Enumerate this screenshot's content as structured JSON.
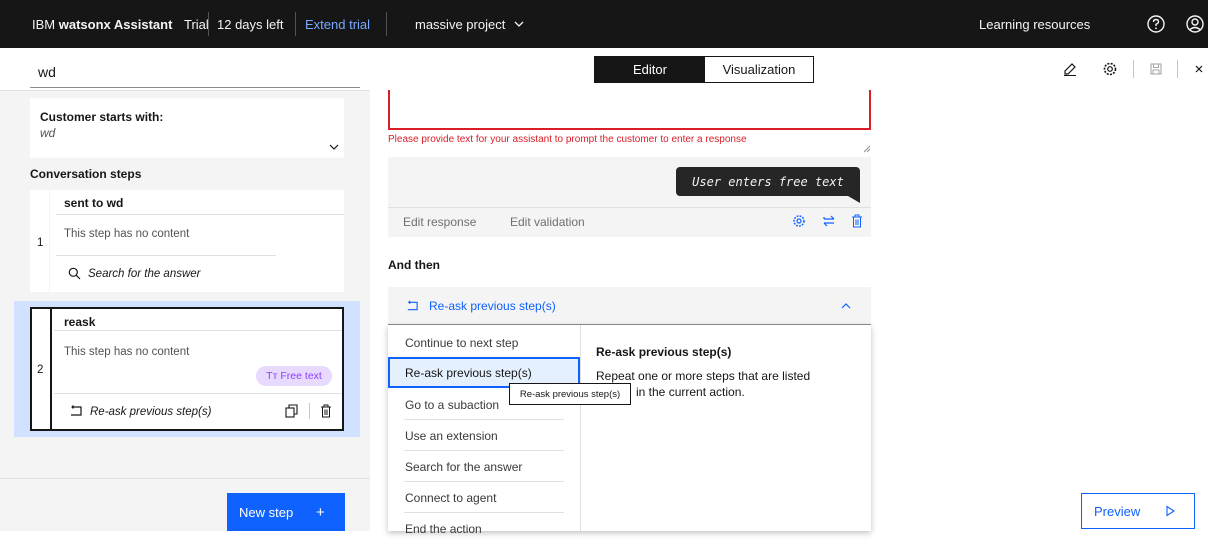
{
  "topbar": {
    "brand_company": "IBM",
    "brand_product": "watsonx Assistant",
    "plan": "Trial",
    "days_left": "12 days left",
    "extend_trial": "Extend trial",
    "project": "massive project",
    "learning_resources": "Learning resources",
    "icons": [
      "help-icon",
      "user-icon"
    ]
  },
  "action_search": {
    "value": "wd"
  },
  "view_toggle": {
    "editor": "Editor",
    "visualization": "Visualization",
    "selected": "Editor"
  },
  "toolbar_icons": [
    "edit-icon",
    "settings-icon",
    "save-icon",
    "close-icon"
  ],
  "left_panel": {
    "customer_starts_label": "Customer starts with:",
    "customer_starts_value": "wd",
    "steps_heading": "Conversation steps",
    "steps": [
      {
        "number": "1",
        "title": "sent to wd",
        "content": "This step has no content",
        "footer": "Search for the answer"
      },
      {
        "number": "2",
        "title": "reask",
        "content": "This step has no content",
        "badge": "Free text",
        "badge_prefix": "Tт",
        "footer": "Re-ask previous step(s)"
      }
    ],
    "new_step": "New step",
    "new_step_plus": "+"
  },
  "editor": {
    "error_message": "Please provide text for your assistant to prompt the customer to enter a response",
    "bubble": "User enters free text",
    "edit_response": "Edit response",
    "edit_validation": "Edit validation",
    "and_then": "And then",
    "dropdown_selected": "Re-ask previous step(s)",
    "options": [
      "Continue to next step",
      "Re-ask previous step(s)",
      "Go to a subaction",
      "Use an extension",
      "Search for the answer",
      "Connect to agent",
      "End the action"
    ],
    "detail_title": "Re-ask previous step(s)",
    "detail_line1": "Repeat one or more steps that are listed",
    "detail_line2": "in the current action.",
    "tooltip": "Re-ask previous step(s)"
  },
  "preview": {
    "label": "Preview"
  },
  "colors": {
    "accent": "#0f62fe",
    "error": "#da1e28",
    "topbar": "#161616"
  }
}
